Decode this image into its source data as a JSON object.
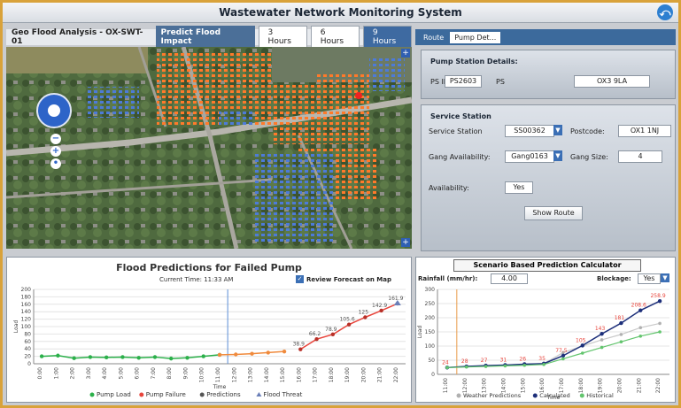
{
  "app": {
    "title": "Wastewater Network Monitoring System"
  },
  "map_tabs": {
    "analysis_label": "Geo Flood Analysis - OX-SWT-01",
    "predict_label": "Predict Flood Impact",
    "hours": [
      "3 Hours",
      "6 Hours",
      "9 Hours"
    ],
    "active_hour": "9 Hours"
  },
  "right_tabs": {
    "route": "Route",
    "pump": "Pump Det..."
  },
  "pump_station": {
    "header": "Pump Station Details:",
    "ps_id_label": "PS ID:",
    "ps_id_value": "PS2603",
    "ps_label": "PS",
    "ps_value": "OX3 9LA"
  },
  "service_station": {
    "header": "Service Station",
    "station_label": "Service Station",
    "station_value": "SS00362",
    "postcode_label": "Postcode:",
    "postcode_value": "OX1 1NJ",
    "gang_avail_label": "Gang Availability:",
    "gang_avail_value": "Gang0163",
    "gang_size_label": "Gang Size:",
    "gang_size_value": "4",
    "availability_label": "Availability:",
    "availability_value": "Yes",
    "show_route_label": "Show Route"
  },
  "flood_chart": {
    "title": "Flood Predictions for Failed Pump",
    "current_time": "Current Time: 11:33 AM",
    "review_label": "Review Forecast on Map",
    "y_label": "Load",
    "x_label": "Time",
    "legend": [
      "Pump Load",
      "Pump Failure",
      "Predictions",
      "Flood Threat"
    ],
    "colors": {
      "pump_load": "#2bb04a",
      "pump_failure": "#e8453c",
      "predictions": "#555555",
      "flood_threat": "#6a7fb8"
    }
  },
  "scenario": {
    "title": "Scenario Based Prediction Calculator",
    "rainfall_label": "Rainfall (mm/hr):",
    "rainfall_value": "4.00",
    "blockage_label": "Blockage:",
    "blockage_value": "Yes",
    "y_label": "Load",
    "x_label": "Time",
    "legend": [
      "Weather Predictions",
      "Calculated",
      "Historical"
    ]
  },
  "chart_data": [
    {
      "type": "line",
      "title": "Flood Predictions for Failed Pump",
      "xlabel": "Time",
      "ylabel": "Load",
      "ylim": [
        0,
        200
      ],
      "yticks": [
        0,
        20,
        40,
        60,
        80,
        100,
        120,
        140,
        160,
        180,
        200
      ],
      "categories": [
        "0:00",
        "1:00",
        "2:00",
        "3:00",
        "4:00",
        "5:00",
        "6:00",
        "7:00",
        "8:00",
        "9:00",
        "10:00",
        "11:00",
        "12:00",
        "13:00",
        "14:00",
        "15:00",
        "16:00",
        "17:00",
        "18:00",
        "19:00",
        "20:00",
        "21:00",
        "22:00"
      ],
      "current_index": 11.5,
      "series": [
        {
          "name": "Pump Load",
          "values": [
            20,
            22,
            15,
            18,
            17,
            18,
            16,
            18,
            14,
            16,
            20,
            24,
            null,
            null,
            null,
            null,
            null,
            null,
            null,
            null,
            null,
            null,
            null
          ]
        },
        {
          "name": "Pump Failure",
          "values": [
            null,
            null,
            null,
            null,
            null,
            null,
            null,
            null,
            null,
            null,
            null,
            24,
            25,
            27,
            30,
            33,
            null,
            null,
            null,
            null,
            null,
            null,
            null
          ]
        },
        {
          "name": "Predictions",
          "values": [
            null,
            null,
            null,
            null,
            null,
            null,
            null,
            null,
            null,
            null,
            null,
            null,
            null,
            null,
            null,
            null,
            38.9,
            66.2,
            78.9,
            105.6,
            125,
            142.9,
            161.9
          ]
        }
      ],
      "data_labels": [
        {
          "index": 16,
          "text": "38.9"
        },
        {
          "index": 17,
          "text": "66.2"
        },
        {
          "index": 18,
          "text": "78.9"
        },
        {
          "index": 19,
          "text": "105.6"
        },
        {
          "index": 20,
          "text": "125"
        },
        {
          "index": 21,
          "text": "142.9"
        },
        {
          "index": 22,
          "text": "161.9"
        }
      ]
    },
    {
      "type": "line",
      "title": "Scenario Based Prediction Calculator",
      "xlabel": "Time",
      "ylabel": "Load",
      "ylim": [
        0,
        300
      ],
      "yticks": [
        0,
        50,
        100,
        150,
        200,
        250,
        300
      ],
      "categories": [
        "11:00",
        "12:00",
        "13:00",
        "14:00",
        "15:00",
        "16:00",
        "17:00",
        "18:00",
        "19:00",
        "20:00",
        "21:00",
        "22:00"
      ],
      "current_index": 0.5,
      "series": [
        {
          "name": "Weather Predictions",
          "values": [
            24,
            28,
            31,
            33,
            36,
            38,
            77,
            100,
            122,
            141,
            165,
            180
          ]
        },
        {
          "name": "Calculated",
          "values": [
            24,
            28,
            31,
            33,
            36,
            38,
            66,
            102,
            143,
            181,
            226,
            258.9
          ]
        },
        {
          "name": "Historical",
          "values": [
            24,
            26,
            28,
            30,
            32,
            35,
            55,
            75,
            95,
            115,
            135,
            150
          ]
        }
      ],
      "data_labels": [
        {
          "index": 0,
          "text": "24"
        },
        {
          "index": 1,
          "text": "28"
        },
        {
          "index": 2,
          "text": "27"
        },
        {
          "index": 3,
          "text": "31"
        },
        {
          "index": 4,
          "text": "26"
        },
        {
          "index": 5,
          "text": "35"
        },
        {
          "index": 6,
          "text": "77.5"
        },
        {
          "index": 7,
          "text": "105"
        },
        {
          "index": 8,
          "text": "143"
        },
        {
          "index": 9,
          "text": "181"
        },
        {
          "index": 10,
          "text": "208.6"
        },
        {
          "index": 11,
          "text": "258.9"
        }
      ]
    }
  ]
}
